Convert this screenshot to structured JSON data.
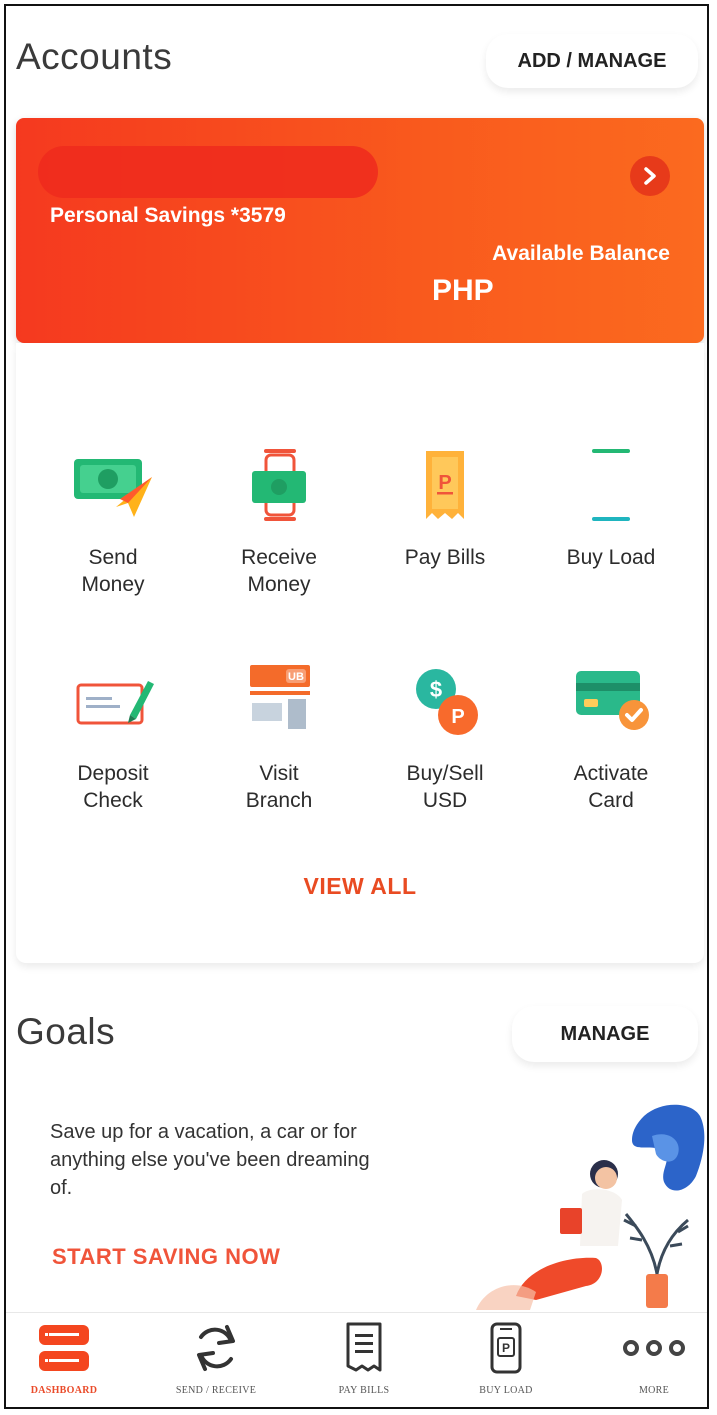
{
  "accounts": {
    "title": "Accounts",
    "add_manage_label": "ADD / MANAGE",
    "card": {
      "name": "Personal Savings *3579",
      "balance_label": "Available Balance",
      "currency": "PHP"
    }
  },
  "actions": [
    {
      "label": "Send\nMoney",
      "icon": "send-money-icon"
    },
    {
      "label": "Receive\nMoney",
      "icon": "receive-money-icon"
    },
    {
      "label": "Pay Bills",
      "icon": "pay-bills-icon"
    },
    {
      "label": "Buy Load",
      "icon": "buy-load-icon"
    },
    {
      "label": "Deposit\nCheck",
      "icon": "deposit-check-icon"
    },
    {
      "label": "Visit\nBranch",
      "icon": "visit-branch-icon"
    },
    {
      "label": "Buy/Sell\nUSD",
      "icon": "buy-sell-usd-icon"
    },
    {
      "label": "Activate\nCard",
      "icon": "activate-card-icon"
    }
  ],
  "view_all_label": "VIEW ALL",
  "goals": {
    "title": "Goals",
    "manage_label": "MANAGE",
    "description": "Save up for a vacation, a car or for anything else you've been dreaming of.",
    "cta_label": "START SAVING NOW"
  },
  "bottom_nav": [
    {
      "label": "DASHBOARD",
      "icon": "dashboard-icon",
      "active": true
    },
    {
      "label": "SEND / RECEIVE",
      "icon": "send-receive-icon",
      "active": false
    },
    {
      "label": "PAY BILLS",
      "icon": "pay-bills-receipt-icon",
      "active": false
    },
    {
      "label": "BUY LOAD",
      "icon": "buy-load-phone-icon",
      "active": false
    },
    {
      "label": "MORE",
      "icon": "more-icon",
      "active": false
    }
  ],
  "colors": {
    "accent": "#f4461f",
    "cta": "#e94b22",
    "green": "#2fbf7a",
    "teal": "#1fb5bf"
  }
}
